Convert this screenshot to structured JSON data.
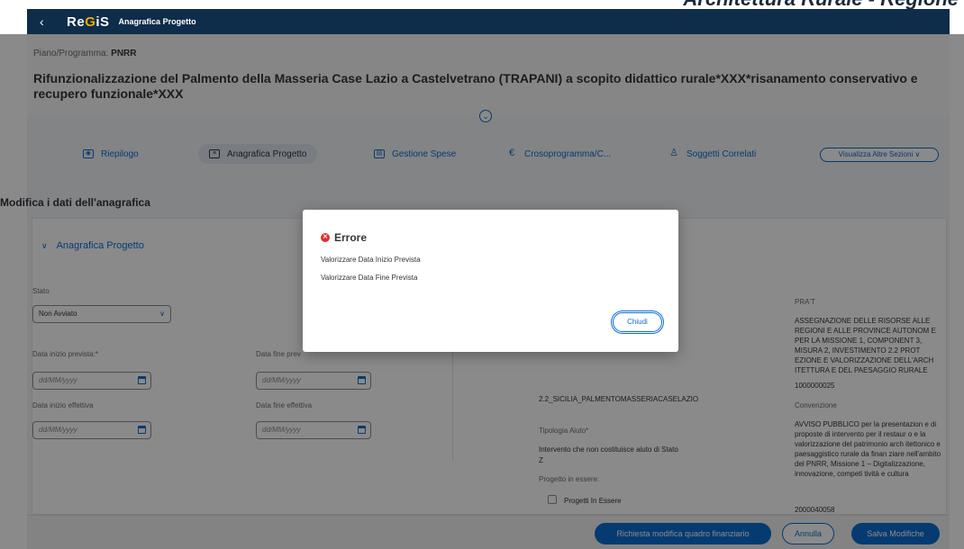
{
  "top_banner": {
    "text": "Architettura Rurale - Regione"
  },
  "shell": {
    "back_icon": "chevron-left-icon",
    "back_glyph": "‹",
    "logo_a": "Re",
    "logo_b": "G",
    "logo_c": "iS",
    "title": "Anagrafica Progetto"
  },
  "header": {
    "piano_label": "Piano/Programma:",
    "piano_value": "PNRR",
    "title": "Rifunzionalizzazione del Palmento della Masseria Case Lazio a Castelvetrano (TRAPANI) a scopito didattico rurale*XXX*risanamento conservativo e recupero funzionale*XXX",
    "collapse_glyph": "⌄"
  },
  "tabs": [
    {
      "label": "Riepilogo",
      "icon": "eye-icon",
      "glyph": "◉"
    },
    {
      "label": "Anagrafica Progetto",
      "icon": "document-icon",
      "glyph": "≡"
    },
    {
      "label": "Gestione Spese",
      "icon": "expense-icon",
      "glyph": "▤"
    },
    {
      "label": "Crosoprogramma/C...",
      "icon": "euro-icon",
      "glyph": "€"
    },
    {
      "label": "Soggetti Correlati",
      "icon": "person-icon",
      "glyph": "♙"
    }
  ],
  "altre_sezioni": "Visualizza Altre Sezioni ∨",
  "section_title": "Modifica i dati dell'anagrafica",
  "panel": {
    "title": "Anagrafica Progetto",
    "chevron": "∨",
    "stato_label": "Stato",
    "stato_value": "Non Avviato",
    "dd_glyph": "∨",
    "data_inizio_prevista_label": "Data inizio prevista:*",
    "data_fine_prevista_label": "Data fine prev",
    "data_inizio_effettiva_label": "Data inizio effettiva",
    "data_fine_effettiva_label": "Data fine effettiva",
    "date_placeholder": "dd/MM/yyyy",
    "codice_value": "2.2_SICILIA_PALMENTOMASSERIACASELAZIO",
    "tipologia_label": "Tipologia Aiuto*",
    "tipologia_value_1": "Intervento che non costituisce aiuto di Stato",
    "tipologia_value_2": "Z",
    "progetto_essere_label": "Progetto in essere:",
    "progetti_essere_check": "Progetti In Essere",
    "prat_label": "PRA'T",
    "prat_value": "ASSEGNAZIONE DELLE RISORSE ALLE REGIONI E ALLE PROVINCE AUTONOM E PER LA MISSIONE 1, COMPONENT 3, MISURA 2, INVESTIMENTO 2.2 PROT EZIONE E VALORIZZAZIONE DELL'ARCH ITETTURA E DEL PAESAGGIO RURALE",
    "prat_code": "1000000025",
    "convenzione_label": "Convenzione",
    "convenzione_value": "AVVISO PUBBLICO per la presentazion e di proposte di intervento per il restaur o e la valorizzazione del patrimonio arch itettonico e paesaggistico rurale da finan ziare nell'ambito del PNRR, Missione 1 – Digitalizzazione, innovazione, competi tività e cultura",
    "convenzione_code": "2000040058"
  },
  "footer": {
    "richiesta": "Richiesta modifica quadro finanziario",
    "annulla": "Annulla",
    "salva": "Salva Modifiche"
  },
  "dialog": {
    "title": "Errore",
    "error_glyph": "✕",
    "msg1": "Valorizzare Data Inizio Prevista",
    "msg2": "Valorizzare Data Fine Prevista",
    "close": "Chiudi"
  }
}
